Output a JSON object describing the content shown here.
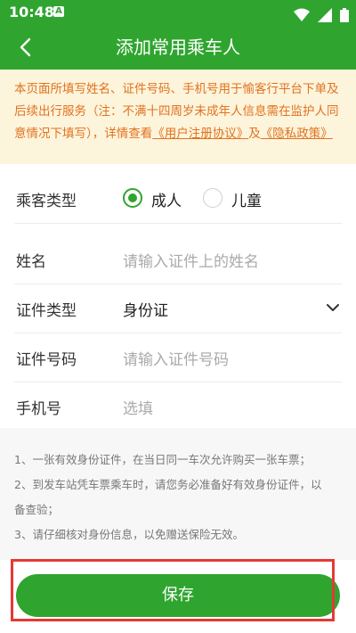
{
  "status_bar": {
    "time": "10:48",
    "badge": "A"
  },
  "header": {
    "title": "添加常用乘车人",
    "back_icon": "chevron-left-icon"
  },
  "notice": {
    "text": "本页面所填写姓名、证件号码、手机号用于愉客行平台下单及后续出行服务（注：不满十四周岁未成年人信息需在监护人同意情况下填写），详情查看",
    "link_agreement": "《用户注册协议》",
    "and": "及",
    "link_privacy": "《隐私政策》"
  },
  "form": {
    "passenger_type": {
      "label": "乘客类型",
      "options": [
        {
          "label": "成人",
          "checked": true
        },
        {
          "label": "儿童",
          "checked": false
        }
      ]
    },
    "name": {
      "label": "姓名",
      "placeholder": "请输入证件上的姓名"
    },
    "id_type": {
      "label": "证件类型",
      "value": "身份证"
    },
    "id_number": {
      "label": "证件号码",
      "placeholder": "请输入证件号码"
    },
    "phone": {
      "label": "手机号",
      "placeholder": "选填"
    }
  },
  "tips": [
    "1、一张有效身份证件，在当日同一车次允许购买一张车票；",
    "2、到发车站凭车票乘车时，请您务必准备好有效身份证件，以",
    "备查验；",
    "3、请仔细核对身份信息，以免赠送保险无效。"
  ],
  "save_label": "保存",
  "colors": {
    "brand_green": "#2fa52f",
    "notice_bg": "#fdf4dc",
    "notice_text": "#e0731f",
    "highlight": "#e53935"
  }
}
